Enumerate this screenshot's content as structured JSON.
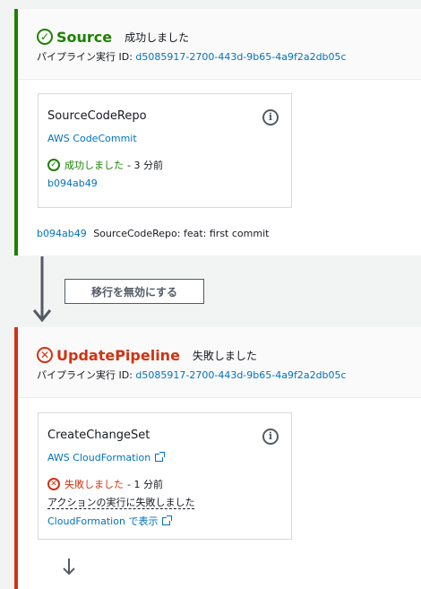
{
  "source_stage": {
    "name": "Source",
    "status": "成功しました",
    "exec_label": "パイプライン実行 ID:",
    "exec_id": "d5085917-2700-443d-9b65-4a9f2a2db05c",
    "action": {
      "name": "SourceCodeRepo",
      "provider": "AWS CodeCommit",
      "status": "成功しました",
      "time": "- 3 分前",
      "revision": "b094ab49"
    },
    "commit": {
      "id": "b094ab49",
      "message": "SourceCodeRepo: feat: first commit"
    }
  },
  "transition": {
    "button_label": "移行を無効にする"
  },
  "update_stage": {
    "name": "UpdatePipeline",
    "status": "失敗しました",
    "exec_label": "パイプライン実行 ID:",
    "exec_id": "d5085917-2700-443d-9b65-4a9f2a2db05c",
    "action": {
      "name": "CreateChangeSet",
      "provider": "AWS CloudFormation",
      "status": "失敗しました",
      "time": "- 1 分前",
      "error": "アクションの実行に失敗しました",
      "view_link": "CloudFormation で表示"
    }
  },
  "icons": {
    "info": "i",
    "check": "✓",
    "x": "✕"
  },
  "colors": {
    "success": "#1d8102",
    "failed": "#d13212",
    "link": "#0073bb"
  }
}
